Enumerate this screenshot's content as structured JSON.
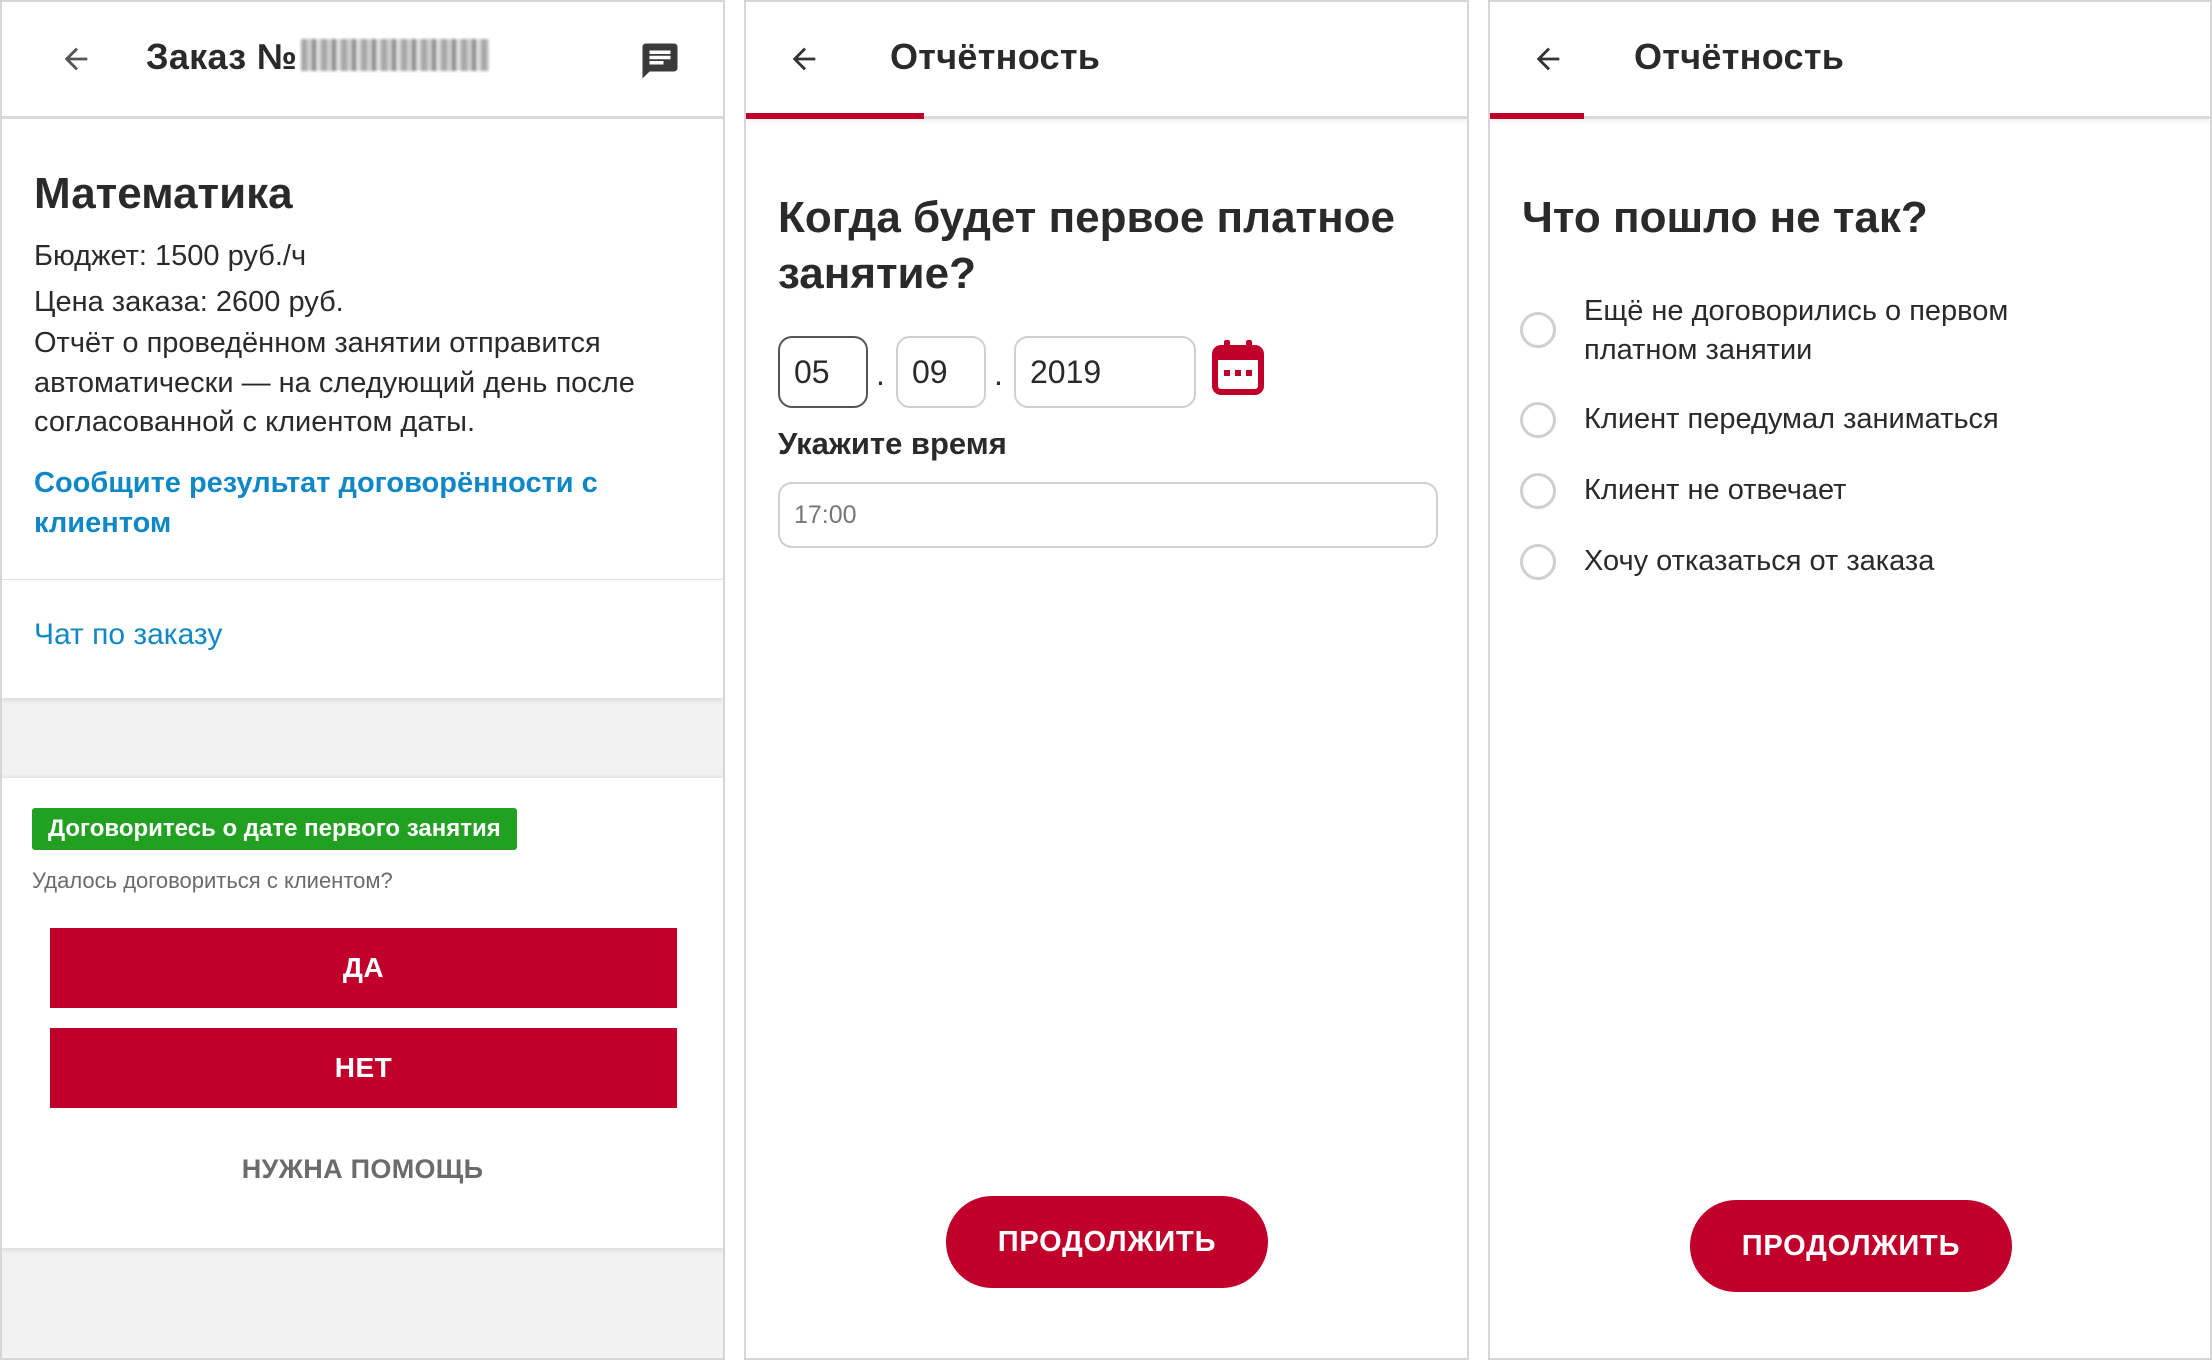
{
  "screen1": {
    "title_prefix": "Заказ №",
    "subject": "Математика",
    "budget": "Бюджет: 1500 руб./ч",
    "price": "Цена заказа: 2600 руб.",
    "note": "Отчёт о проведённом занятии отправится автоматически — на следующий день после согласованной с клиентом даты.",
    "report_link": "Сообщите результат договорённости с клиентом",
    "chat_link": "Чат по заказу",
    "badge": "Договоритесь о дате первого занятия",
    "question": "Удалось договориться с клиентом?",
    "yes_label": "ДА",
    "no_label": "НЕТ",
    "help_label": "НУЖНА ПОМОЩЬ"
  },
  "screen2": {
    "title": "Отчётность",
    "question": "Когда будет первое платное занятие?",
    "date": {
      "day": "05",
      "month": "09",
      "year": "2019",
      "separator": "."
    },
    "time_label": "Укажите время",
    "time_placeholder": "17:00",
    "continue_label": "ПРОДОЛЖИТЬ"
  },
  "screen3": {
    "title": "Отчётность",
    "question": "Что пошло не так?",
    "options": [
      "Ещё не договорились о первом платном занятии",
      "Клиент передумал заниматься",
      "Клиент не отвечает",
      "Хочу отказаться от заказа"
    ],
    "continue_label": "ПРОДОЛЖИТЬ"
  },
  "colors": {
    "accent": "#c0002a",
    "link": "#1188c6",
    "badge": "#21a021",
    "text": "#2a2a2a"
  },
  "icons": {
    "back": "arrow-left-icon",
    "chat": "message-icon",
    "calendar": "calendar-icon",
    "radio": "radio-unchecked-icon"
  }
}
